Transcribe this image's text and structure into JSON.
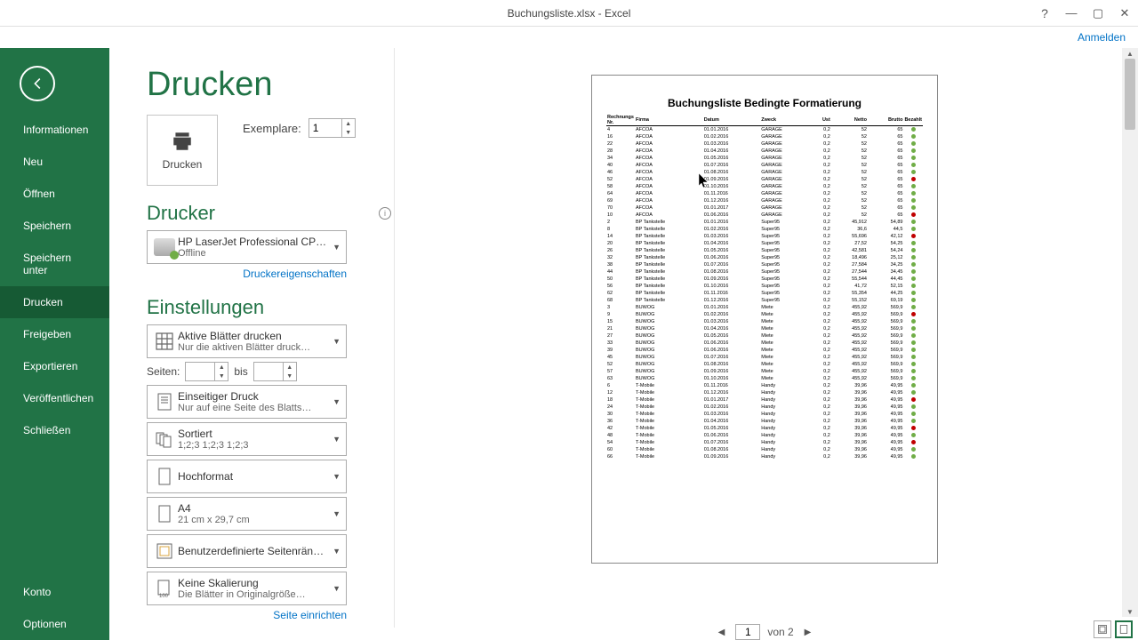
{
  "window": {
    "title": "Buchungsliste.xlsx - Excel",
    "signin": "Anmelden"
  },
  "sidebar": {
    "items": [
      "Informationen",
      "Neu",
      "Öffnen",
      "Speichern",
      "Speichern unter",
      "Drucken",
      "Freigeben",
      "Exportieren",
      "Veröffentlichen",
      "Schließen"
    ],
    "footer": [
      "Konto",
      "Optionen"
    ],
    "active_index": 5
  },
  "page_title": "Drucken",
  "print": {
    "button": "Drucken",
    "copies_label": "Exemplare:",
    "copies_value": "1"
  },
  "printer": {
    "section": "Drucker",
    "name": "HP LaserJet Professional CP…",
    "status": "Offline",
    "props_link": "Druckereigenschaften"
  },
  "settings": {
    "section": "Einstellungen",
    "what": {
      "main": "Aktive Blätter drucken",
      "sub": "Nur die aktiven Blätter druck…"
    },
    "pages": {
      "label": "Seiten:",
      "to": "bis",
      "from": "",
      "to_val": ""
    },
    "sides": {
      "main": "Einseitiger Druck",
      "sub": "Nur auf eine Seite des Blatts…"
    },
    "collate": {
      "main": "Sortiert",
      "sub": "1;2;3    1;2;3    1;2;3"
    },
    "orient": {
      "main": "Hochformat",
      "sub": ""
    },
    "paper": {
      "main": "A4",
      "sub": "21  cm x 29,7  cm"
    },
    "margins": {
      "main": "Benutzerdefinierte Seitenrän…",
      "sub": ""
    },
    "scale": {
      "main": "Keine Skalierung",
      "sub": "Die Blätter in Originalgröße…"
    },
    "page_setup": "Seite einrichten"
  },
  "pager": {
    "current": "1",
    "total": "von 2"
  },
  "preview": {
    "title": "Buchungsliste Bedingte Formatierung",
    "headers": [
      "Rechnungs Nr.",
      "Firma",
      "Datum",
      "Zweck",
      "Ust",
      "Netto",
      "Brutto",
      "Bezahlt"
    ]
  },
  "chart_data": {
    "type": "table",
    "title": "Buchungsliste Bedingte Formatierung",
    "columns": [
      "Rechnungs Nr.",
      "Firma",
      "Datum",
      "Zweck",
      "Ust",
      "Netto",
      "Brutto",
      "Bezahlt"
    ],
    "rows": [
      [
        "4",
        "AFCOA",
        "01.01.2016",
        "GARAGE",
        "0,2",
        "52",
        "65",
        "green"
      ],
      [
        "16",
        "AFCOA",
        "01.02.2016",
        "GARAGE",
        "0,2",
        "52",
        "65",
        "green"
      ],
      [
        "22",
        "AFCOA",
        "01.03.2016",
        "GARAGE",
        "0,2",
        "52",
        "65",
        "green"
      ],
      [
        "28",
        "AFCOA",
        "01.04.2016",
        "GARAGE",
        "0,2",
        "52",
        "65",
        "green"
      ],
      [
        "34",
        "AFCOA",
        "01.05.2016",
        "GARAGE",
        "0,2",
        "52",
        "65",
        "green"
      ],
      [
        "40",
        "AFCOA",
        "01.07.2016",
        "GARAGE",
        "0,2",
        "52",
        "65",
        "green"
      ],
      [
        "46",
        "AFCOA",
        "01.08.2016",
        "GARAGE",
        "0,2",
        "52",
        "65",
        "green"
      ],
      [
        "52",
        "AFCOA",
        "01.09.2016",
        "GARAGE",
        "0,2",
        "52",
        "65",
        "red"
      ],
      [
        "58",
        "AFCOA",
        "01.10.2016",
        "GARAGE",
        "0,2",
        "52",
        "65",
        "green"
      ],
      [
        "64",
        "AFCOA",
        "01.11.2016",
        "GARAGE",
        "0,2",
        "52",
        "65",
        "green"
      ],
      [
        "69",
        "AFCOA",
        "01.12.2016",
        "GARAGE",
        "0,2",
        "52",
        "65",
        "green"
      ],
      [
        "70",
        "AFCOA",
        "01.01.2017",
        "GARAGE",
        "0,2",
        "52",
        "65",
        "green"
      ],
      [
        "10",
        "AFCOA",
        "01.06.2016",
        "GARAGE",
        "0,2",
        "52",
        "65",
        "red"
      ],
      [
        "2",
        "BP Tankstelle",
        "01.01.2016",
        "Super95",
        "0,2",
        "45,912",
        "54,89",
        "green"
      ],
      [
        "8",
        "BP Tankstelle",
        "01.02.2016",
        "Super95",
        "0,2",
        "36,6",
        "44,5",
        "green"
      ],
      [
        "14",
        "BP Tankstelle",
        "01.03.2016",
        "Super95",
        "0,2",
        "55,696",
        "42,12",
        "red"
      ],
      [
        "20",
        "BP Tankstelle",
        "01.04.2016",
        "Super95",
        "0,2",
        "27,52",
        "54,25",
        "green"
      ],
      [
        "26",
        "BP Tankstelle",
        "01.05.2016",
        "Super95",
        "0,2",
        "42,581",
        "54,24",
        "green"
      ],
      [
        "32",
        "BP Tankstelle",
        "01.06.2016",
        "Super95",
        "0,2",
        "18,496",
        "25,12",
        "green"
      ],
      [
        "38",
        "BP Tankstelle",
        "01.07.2016",
        "Super95",
        "0,2",
        "27,584",
        "34,25",
        "green"
      ],
      [
        "44",
        "BP Tankstelle",
        "01.08.2016",
        "Super95",
        "0,2",
        "27,544",
        "34,45",
        "green"
      ],
      [
        "50",
        "BP Tankstelle",
        "01.09.2016",
        "Super95",
        "0,2",
        "55,544",
        "44,45",
        "green"
      ],
      [
        "56",
        "BP Tankstelle",
        "01.10.2016",
        "Super95",
        "0,2",
        "41,72",
        "52,15",
        "green"
      ],
      [
        "62",
        "BP Tankstelle",
        "01.11.2016",
        "Super95",
        "0,2",
        "55,354",
        "44,25",
        "green"
      ],
      [
        "68",
        "BP Tankstelle",
        "01.12.2016",
        "Super95",
        "0,2",
        "55,152",
        "69,19",
        "green"
      ],
      [
        "3",
        "BUWOG",
        "01.01.2016",
        "Miete",
        "0,2",
        "455,92",
        "569,9",
        "green"
      ],
      [
        "9",
        "BUWOG",
        "01.02.2016",
        "Miete",
        "0,2",
        "455,92",
        "569,9",
        "red"
      ],
      [
        "15",
        "BUWOG",
        "01.03.2016",
        "Miete",
        "0,2",
        "455,92",
        "569,9",
        "green"
      ],
      [
        "21",
        "BUWOG",
        "01.04.2016",
        "Miete",
        "0,2",
        "455,92",
        "569,9",
        "green"
      ],
      [
        "27",
        "BUWOG",
        "01.05.2016",
        "Miete",
        "0,2",
        "455,92",
        "569,9",
        "green"
      ],
      [
        "33",
        "BUWOG",
        "01.06.2016",
        "Miete",
        "0,2",
        "455,92",
        "569,9",
        "green"
      ],
      [
        "39",
        "BUWOG",
        "01.06.2016",
        "Miete",
        "0,2",
        "455,92",
        "569,9",
        "green"
      ],
      [
        "45",
        "BUWOG",
        "01.07.2016",
        "Miete",
        "0,2",
        "455,92",
        "569,9",
        "green"
      ],
      [
        "52",
        "BUWOG",
        "01.08.2016",
        "Miete",
        "0,2",
        "455,92",
        "569,9",
        "green"
      ],
      [
        "57",
        "BUWOG",
        "01.09.2016",
        "Miete",
        "0,2",
        "455,92",
        "569,9",
        "green"
      ],
      [
        "63",
        "BUWOG",
        "01.10.2016",
        "Miete",
        "0,2",
        "455,92",
        "569,9",
        "green"
      ],
      [
        "6",
        "T-Mobile",
        "01.11.2016",
        "Handy",
        "0,2",
        "39,96",
        "49,95",
        "green"
      ],
      [
        "12",
        "T-Mobile",
        "01.12.2016",
        "Handy",
        "0,2",
        "39,96",
        "49,95",
        "green"
      ],
      [
        "18",
        "T-Mobile",
        "01.01.2017",
        "Handy",
        "0,2",
        "39,96",
        "49,95",
        "red"
      ],
      [
        "24",
        "T-Mobile",
        "01.02.2016",
        "Handy",
        "0,2",
        "39,96",
        "49,95",
        "green"
      ],
      [
        "30",
        "T-Mobile",
        "01.03.2016",
        "Handy",
        "0,2",
        "39,96",
        "49,95",
        "green"
      ],
      [
        "36",
        "T-Mobile",
        "01.04.2016",
        "Handy",
        "0,2",
        "39,96",
        "49,95",
        "green"
      ],
      [
        "42",
        "T-Mobile",
        "01.05.2016",
        "Handy",
        "0,2",
        "39,96",
        "49,95",
        "red"
      ],
      [
        "48",
        "T-Mobile",
        "01.06.2016",
        "Handy",
        "0,2",
        "39,96",
        "49,95",
        "green"
      ],
      [
        "54",
        "T-Mobile",
        "01.07.2016",
        "Handy",
        "0,2",
        "39,96",
        "49,95",
        "red"
      ],
      [
        "60",
        "T-Mobile",
        "01.08.2016",
        "Handy",
        "0,2",
        "39,96",
        "49,95",
        "green"
      ],
      [
        "66",
        "T-Mobile",
        "01.09.2016",
        "Handy",
        "0,2",
        "39,96",
        "49,95",
        "green"
      ]
    ]
  }
}
